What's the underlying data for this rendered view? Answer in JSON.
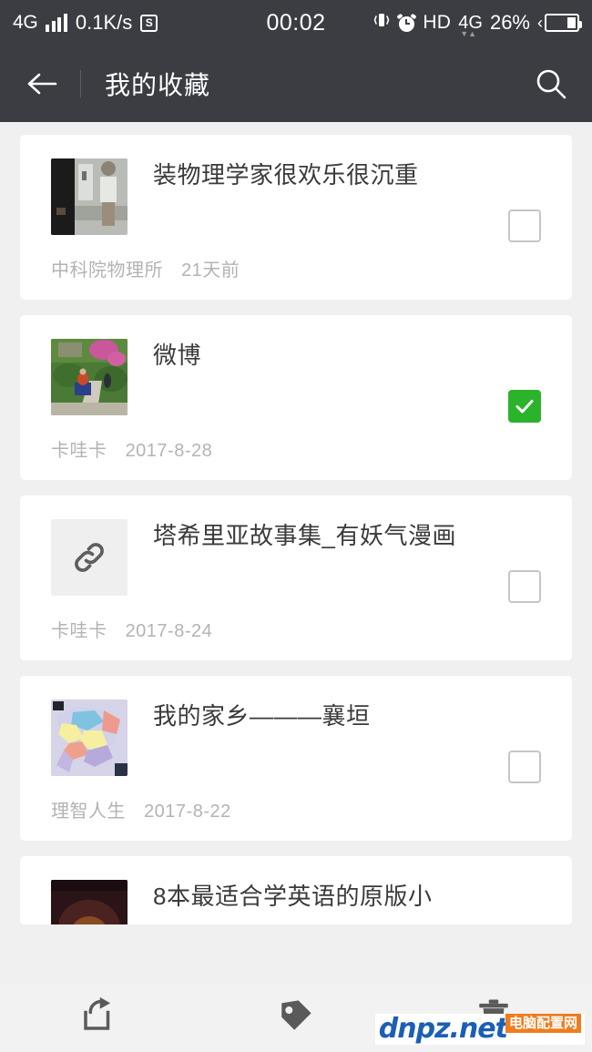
{
  "status_bar": {
    "network_type": "4G",
    "speed": "0.1K/s",
    "sim_badge": "S",
    "clock": "00:02",
    "hd_label": "HD",
    "second_network": "4G",
    "battery_percent": "26%",
    "icons": {
      "signal": "signal-bars-icon",
      "vibrate": "vibrate-icon",
      "alarm": "alarm-clock-icon",
      "battery": "battery-icon"
    }
  },
  "app_bar": {
    "title": "我的收藏",
    "back_icon": "back-arrow-icon",
    "search_icon": "search-icon"
  },
  "list": {
    "items": [
      {
        "title": "装物理学家很欢乐很沉重",
        "source": "中科院物理所",
        "date": "21天前",
        "checked": false,
        "thumb_type": "image",
        "thumb_name": "photo-thumbnail"
      },
      {
        "title": "微博",
        "source": "卡哇卡",
        "date": "2017-8-28",
        "checked": true,
        "thumb_type": "image",
        "thumb_name": "photo-thumbnail"
      },
      {
        "title": "塔希里亚故事集_有妖气漫画",
        "source": "卡哇卡",
        "date": "2017-8-24",
        "checked": false,
        "thumb_type": "link",
        "thumb_name": "link-icon"
      },
      {
        "title": "我的家乡———襄垣",
        "source": "理智人生",
        "date": "2017-8-22",
        "checked": false,
        "thumb_type": "image",
        "thumb_name": "map-thumbnail"
      },
      {
        "title": "8本最适合学英语的原版小",
        "source": "",
        "date": "",
        "checked": false,
        "thumb_type": "image",
        "thumb_name": "photo-thumbnail"
      }
    ]
  },
  "bottom_bar": {
    "actions": [
      {
        "name": "share-button",
        "icon": "share-icon"
      },
      {
        "name": "tag-button",
        "icon": "tag-icon"
      },
      {
        "name": "delete-button",
        "icon": "trash-icon"
      }
    ]
  },
  "watermark": {
    "text": "dnpz.net",
    "badge": "电脑配置网"
  },
  "colors": {
    "app_bar": "#3b3d42",
    "page_background": "#f0f0f0",
    "card": "#ffffff",
    "accent_checked": "#2bb32b",
    "title_text": "#3a3a3a",
    "meta_text": "#b3b3b3",
    "watermark_blue": "#1a5fb4",
    "watermark_orange": "#f07c1e"
  }
}
